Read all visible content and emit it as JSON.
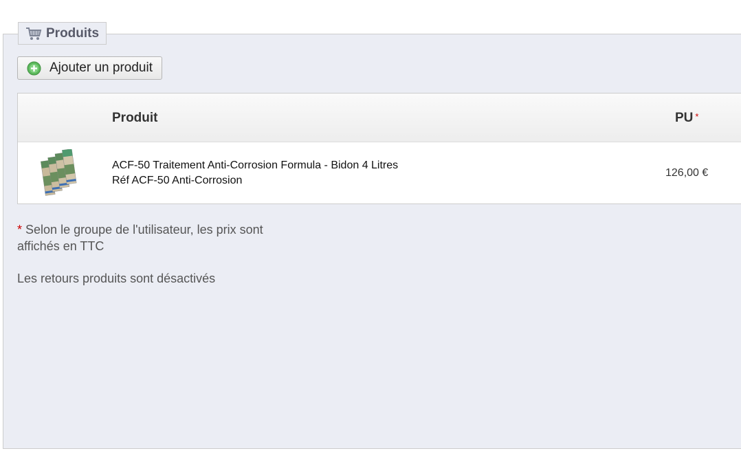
{
  "section": {
    "title": "Produits",
    "icon": "cart-icon"
  },
  "toolbar": {
    "add_label": "Ajouter un produit",
    "add_icon": "plus-circle-icon"
  },
  "table": {
    "columns": {
      "product": "Produit",
      "unit_price": "PU",
      "required_marker": "*"
    },
    "rows": [
      {
        "image": "product-thumbnail",
        "name": "ACF-50 Traitement Anti-Corrosion Formula - Bidon 4 Litres",
        "reference": "Réf ACF-50 Anti-Corrosion",
        "unit_price": "126,00 €"
      }
    ]
  },
  "notes": {
    "asterisk": "*",
    "tax_note": "Selon le groupe de l'utilisateur, les prix sont affichés en TTC",
    "returns_note": "Les retours produits sont désactivés"
  },
  "colors": {
    "panel_bg": "#ebedf4",
    "border": "#cccccc",
    "required": "#cc0000",
    "add_icon": "#4caf50"
  }
}
